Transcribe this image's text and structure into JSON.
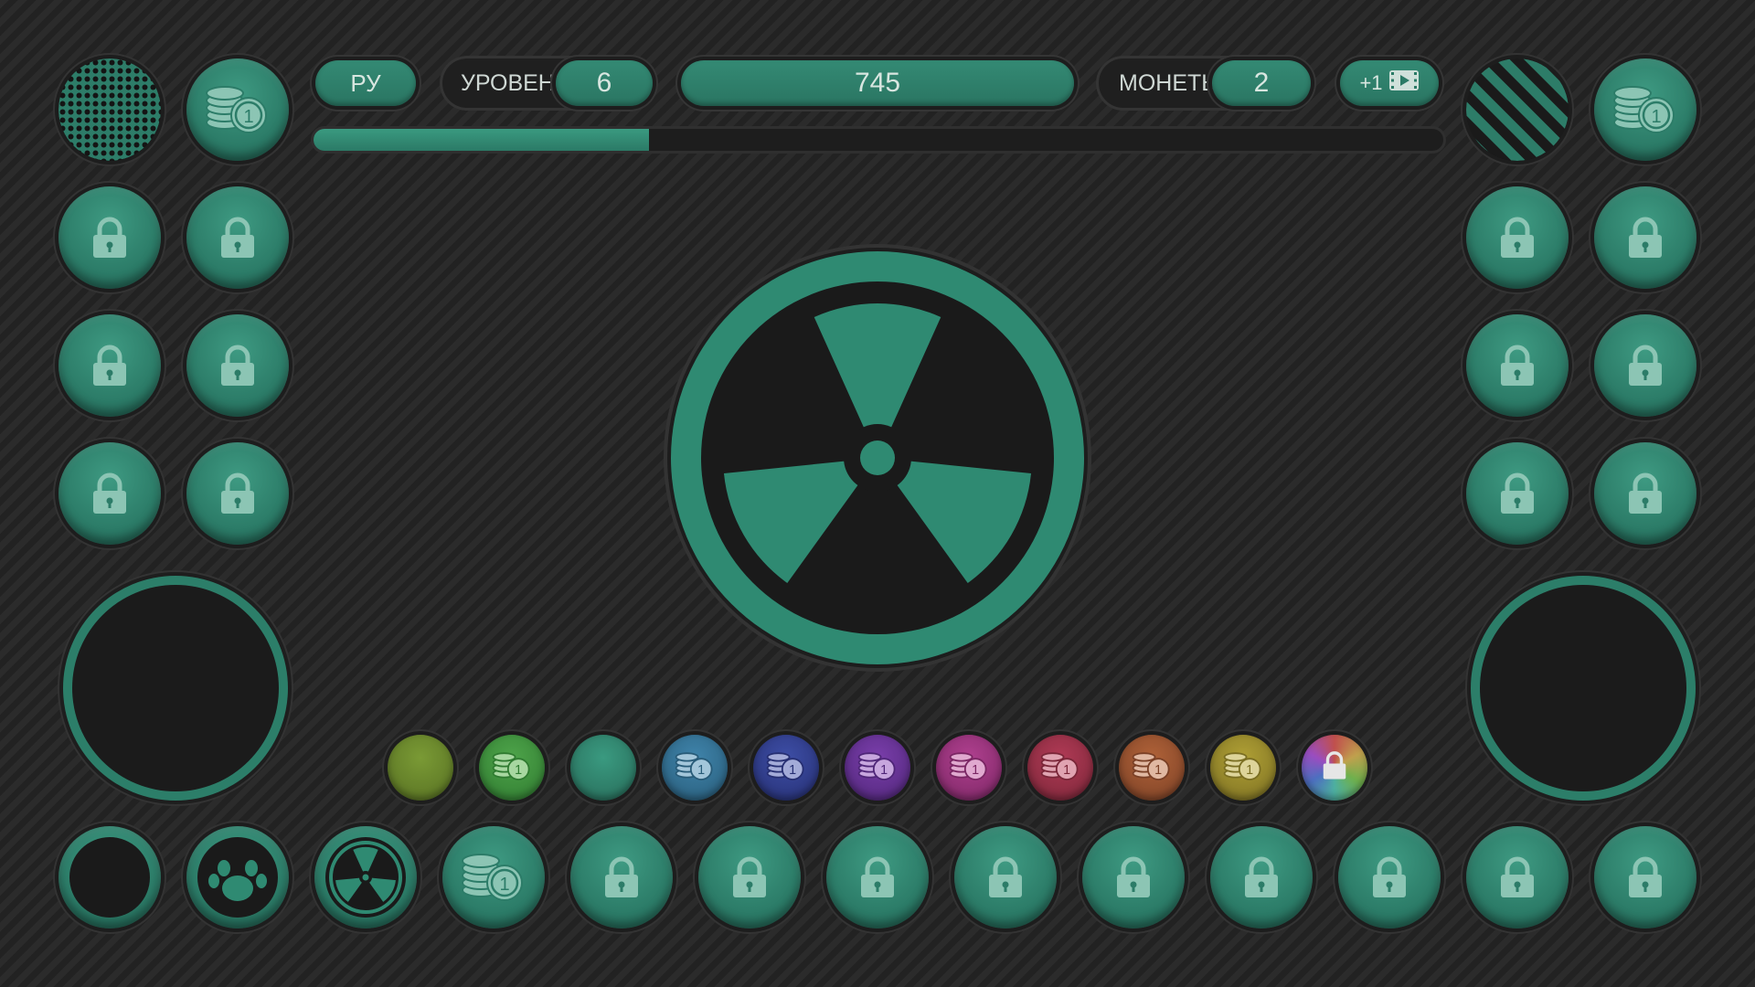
{
  "header": {
    "language_label": "РУ",
    "level_label": "УРОВЕНЬ",
    "level_value": "6",
    "score_value": "745",
    "coins_label": "МОНЕТЫ",
    "coins_value": "2",
    "ad_bonus_label": "+1"
  },
  "progress": {
    "fraction": 0.297
  },
  "colors": {
    "accent": "#2f8a72",
    "background": "#262626",
    "swatches": [
      "#5f7a2a",
      "#3f8a3a",
      "#2f7e68",
      "#2f6c8c",
      "#2e3a86",
      "#5a2f86",
      "#8a2f7a",
      "#8a2f4a",
      "#8a4a2f",
      "#8a7a2f",
      "rainbow"
    ]
  },
  "left_grid": {
    "row1": [
      "texture-dots",
      "coins"
    ],
    "rows_locked": [
      "lock",
      "lock",
      "lock",
      "lock",
      "lock",
      "lock"
    ]
  },
  "right_grid": {
    "row1": [
      "texture-stripes",
      "coins"
    ],
    "rows_locked": [
      "lock",
      "lock",
      "lock",
      "lock",
      "lock",
      "lock"
    ]
  },
  "bottom_row": [
    "ring",
    "paw",
    "radiation",
    "coins",
    "lock",
    "lock",
    "lock",
    "lock",
    "lock",
    "lock",
    "lock",
    "lock",
    "lock"
  ],
  "center_icon": "radiation-icon"
}
